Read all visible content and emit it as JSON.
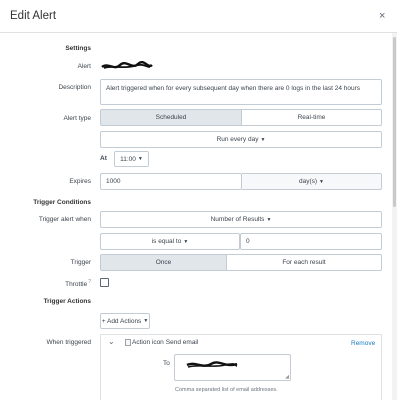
{
  "header": {
    "title": "Edit Alert",
    "close_glyph": "×"
  },
  "sections": {
    "settings": "Settings",
    "trigger_conditions": "Trigger Conditions",
    "trigger_actions": "Trigger Actions"
  },
  "settings": {
    "alert_label": "Alert",
    "description_label": "Description",
    "description_value": "Alert triggered when for every subsequent day when there are 0 logs in the last 24 hours",
    "alert_type_label": "Alert type",
    "alert_type_options": [
      "Scheduled",
      "Real-time"
    ],
    "alert_type_selected": "Scheduled",
    "schedule_value": "Run every day",
    "at_label": "At",
    "at_value": "11:00",
    "expires_label": "Expires",
    "expires_value": "1000",
    "expires_unit": "day(s)"
  },
  "trigger": {
    "when_label": "Trigger alert when",
    "when_value": "Number of Results",
    "comparator": "is equal to",
    "threshold": "0",
    "trigger_label": "Trigger",
    "trigger_options": [
      "Once",
      "For each result"
    ],
    "trigger_selected": "Once",
    "throttle_label": "Throttle",
    "throttle_help": "?"
  },
  "actions": {
    "add_actions": "+ Add Actions",
    "when_triggered_label": "When triggered",
    "chevron": "⌄",
    "action_icon_alt": "Action icon",
    "action_name": "Send email",
    "remove": "Remove",
    "to_label": "To",
    "to_hint": "Comma separated list of email addresses."
  },
  "colors": {
    "active_segment": "#e1e6eb",
    "link": "#1a7bc0",
    "border": "#c3cbd4"
  }
}
